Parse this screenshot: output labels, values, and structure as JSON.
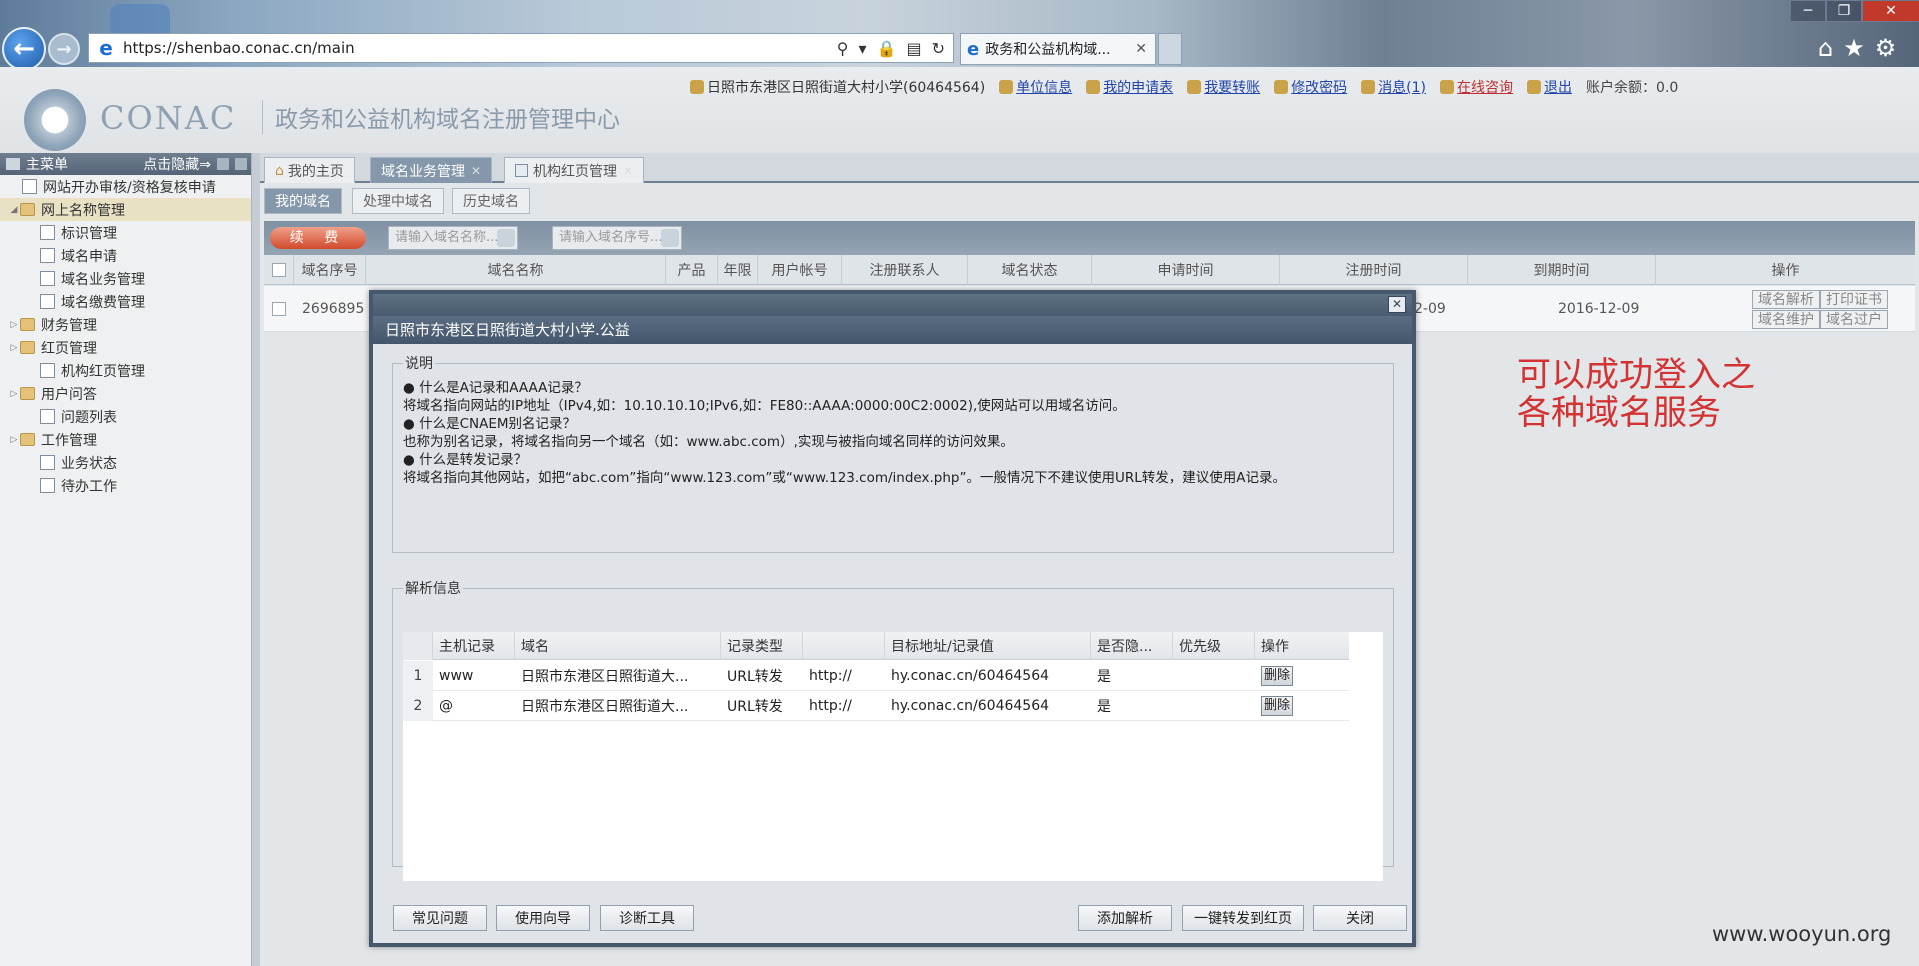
{
  "browser": {
    "url": "https://shenbao.conac.cn/main",
    "tab_title": "政务和公益机构域...",
    "window_controls": [
      "─",
      "❐",
      "✕"
    ]
  },
  "header": {
    "logo_text": "CONAC",
    "site_name": "政务和公益机构域名注册管理中心",
    "user": "日照市东港区日照街道大村小学(60464564)",
    "links": [
      "单位信息",
      "我的申请表",
      "我要转账",
      "修改密码",
      "消息(1)",
      "在线咨询",
      "退出"
    ],
    "balance": "账户余额：0.0"
  },
  "menu": {
    "title": "主菜单",
    "hide_label": "点击隐藏⇒",
    "items": [
      {
        "label": "网站开办审核/资格复核申请",
        "level": 0,
        "kind": "doc"
      },
      {
        "label": "网上名称管理",
        "level": 0,
        "kind": "folder",
        "selected": true
      },
      {
        "label": "标识管理",
        "level": 1,
        "kind": "doc"
      },
      {
        "label": "域名申请",
        "level": 1,
        "kind": "doc"
      },
      {
        "label": "域名业务管理",
        "level": 1,
        "kind": "doc"
      },
      {
        "label": "域名缴费管理",
        "level": 1,
        "kind": "doc"
      },
      {
        "label": "财务管理",
        "level": 0,
        "kind": "folder"
      },
      {
        "label": "红页管理",
        "level": 0,
        "kind": "folder"
      },
      {
        "label": "机构红页管理",
        "level": 1,
        "kind": "doc"
      },
      {
        "label": "用户问答",
        "level": 0,
        "kind": "folder"
      },
      {
        "label": "问题列表",
        "level": 1,
        "kind": "doc"
      },
      {
        "label": "工作管理",
        "level": 0,
        "kind": "folder"
      },
      {
        "label": "业务状态",
        "level": 1,
        "kind": "doc"
      },
      {
        "label": "待办工作",
        "level": 1,
        "kind": "doc"
      }
    ]
  },
  "tabs": [
    "我的主页",
    "域名业务管理",
    "机构红页管理"
  ],
  "subtabs": [
    "我的域名",
    "处理中域名",
    "历史域名"
  ],
  "toolbar": {
    "renew": "续 费",
    "search1_placeholder": "请输入域名名称...",
    "search2_placeholder": "请输入域名序号..."
  },
  "grid": {
    "columns": [
      "域名序号",
      "域名名称",
      "产品",
      "年限",
      "用户帐号",
      "注册联系人",
      "域名状态",
      "申请时间",
      "注册时间",
      "到期时间",
      "操作"
    ],
    "row": {
      "seq": "2696895",
      "reg_time": "2-09",
      "expire": "2016-12-09",
      "ops": [
        "域名解析",
        "打印证书",
        "域名维护",
        "域名过户"
      ]
    }
  },
  "note": "可以成功登入之各种域名服务",
  "watermark": "www.wooyun.org",
  "dialog": {
    "title": "日照市东港区日照街道大村小学.公益",
    "desc_legend": "说明",
    "desc_lines": [
      "● 什么是A记录和AAAA记录？",
      "将域名指向网站的IP地址（IPv4,如：10.10.10.10;IPv6,如：FE80::AAAA:0000:00C2:0002),使网站可以用域名访问。",
      "● 什么是CNAEM别名记录？",
      "也称为别名记录，将域名指向另一个域名（如：www.abc.com）,实现与被指向域名同样的访问效果。",
      "● 什么是转发记录？",
      "将域名指向其他网站，如把“abc.com”指向“www.123.com”或“www.123.com/index.php”。一般情况下不建议使用URL转发，建议使用A记录。"
    ],
    "parse_legend": "解析信息",
    "parse_columns": [
      "主机记录",
      "域名",
      "记录类型",
      "",
      "目标地址/记录值",
      "是否隐...",
      "优先级",
      "操作"
    ],
    "parse_rows": [
      {
        "n": "1",
        "host": "www",
        "domain": "日照市东港区日照街道大...",
        "type": "URL转发",
        "proto": "http://",
        "target": "hy.conac.cn/60464564",
        "hidden": "是",
        "priority": "",
        "op": "删除"
      },
      {
        "n": "2",
        "host": "@",
        "domain": "日照市东港区日照街道大...",
        "type": "URL转发",
        "proto": "http://",
        "target": "hy.conac.cn/60464564",
        "hidden": "是",
        "priority": "",
        "op": "删除"
      }
    ],
    "buttons_left": [
      "常见问题",
      "使用向导",
      "诊断工具"
    ],
    "buttons_right": [
      "添加解析",
      "一键转发到红页",
      "关闭"
    ]
  }
}
